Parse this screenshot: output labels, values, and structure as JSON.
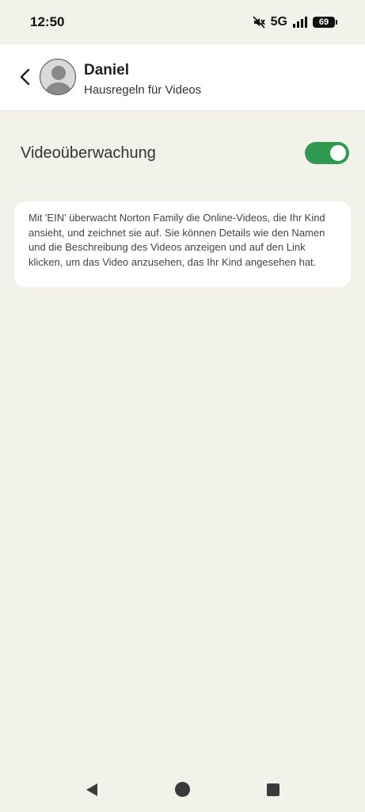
{
  "status_bar": {
    "time": "12:50",
    "network": "5G",
    "battery": "69",
    "icons": [
      "mute-icon",
      "signal-icon",
      "battery-icon"
    ]
  },
  "header": {
    "title": "Daniel",
    "subtitle": "Hausregeln für Videos",
    "back_icon": "chevron-left-icon",
    "avatar_icon": "person-avatar-icon"
  },
  "setting": {
    "label": "Videoüberwachung",
    "enabled": true,
    "accent_color": "#2f9a4f"
  },
  "info": {
    "text": "Mit 'EIN' überwacht Norton Family die Online-Videos, die Ihr Kind ansieht, und zeichnet sie auf. Sie können Details wie den Namen und die Beschreibung des Videos anzeigen und auf den Link klicken, um das Video anzusehen, das Ihr Kind angesehen hat."
  },
  "nav_bar": {
    "icons": [
      "back-triangle-icon",
      "home-circle-icon",
      "recents-square-icon"
    ]
  }
}
